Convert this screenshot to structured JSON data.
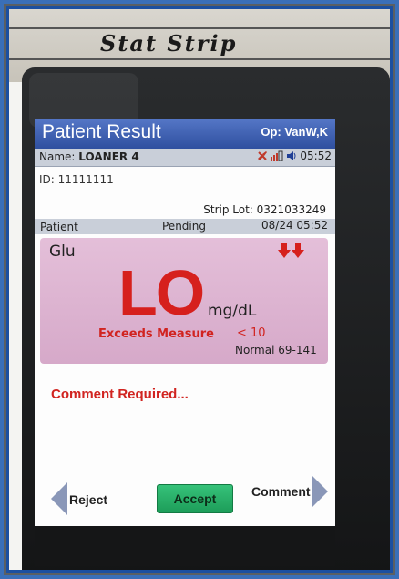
{
  "device": {
    "brand": "Stat Strip"
  },
  "header": {
    "title": "Patient Result",
    "operator": "Op: VanW,K"
  },
  "status": {
    "name_label": "Name:",
    "name_value": "LOANER 4",
    "time": "05:52",
    "icons": [
      "tool-icon",
      "signal-battery-icon",
      "speaker-icon"
    ]
  },
  "patient": {
    "id": "ID: 11111111",
    "strip_lot": "Strip Lot: 0321033249"
  },
  "info_bar": {
    "type": "Patient",
    "state": "Pending",
    "datetime": "08/24 05:52"
  },
  "result": {
    "analyte": "Glu",
    "value": "LO",
    "unit": "mg/dL",
    "flag": "Exceeds Measure",
    "threshold": "< 10",
    "normal_range": "Normal 69-141",
    "trend_icons": [
      "down-arrow-icon",
      "down-arrow-icon"
    ]
  },
  "comment_notice": "Comment Required...",
  "actions": {
    "reject": "Reject",
    "accept": "Accept",
    "comment": "Comment"
  },
  "colors": {
    "title_bar": "#2f4f9f",
    "alert_red": "#d12420",
    "result_panel": "#d6a9c9",
    "accept_green": "#1d9d59"
  }
}
